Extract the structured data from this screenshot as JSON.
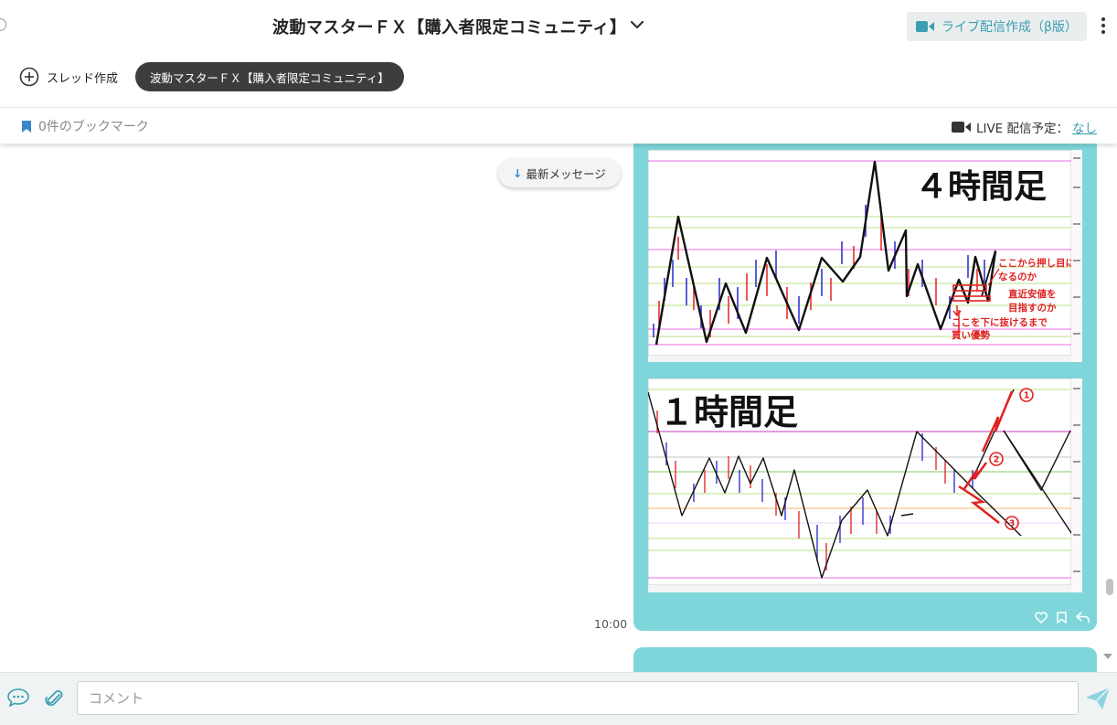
{
  "header": {
    "title": "波動マスターＦＸ【購入者限定コミュニティ】",
    "live_button_label": "ライブ配信作成（β版）"
  },
  "threads": {
    "create_label": "スレッド作成",
    "active_thread": "波動マスターＦＸ【購入者限定コミュニティ】"
  },
  "bookmarks": {
    "label": "0件のブックマーク",
    "live_schedule_label": "LIVE 配信予定：",
    "live_schedule_value": "なし"
  },
  "messages": {
    "latest_button_label": "最新メッセージ",
    "message_time": "10:00",
    "chart1": {
      "title": "４時間足",
      "annotation_1": "ここから押し目に",
      "annotation_2": "なるのか",
      "annotation_3": "直近安値を",
      "annotation_4": "目指すのか",
      "annotation_5": "ここを下に抜けるまで",
      "annotation_6": "買い優勢"
    },
    "chart2": {
      "title": "１時間足",
      "marker_1": "1",
      "marker_2": "2",
      "marker_3": "3"
    }
  },
  "composer": {
    "placeholder": "コメント"
  },
  "colors": {
    "bubble": "#7fd6da",
    "accent": "#3a9fb0",
    "pill": "#3d3d3d"
  }
}
